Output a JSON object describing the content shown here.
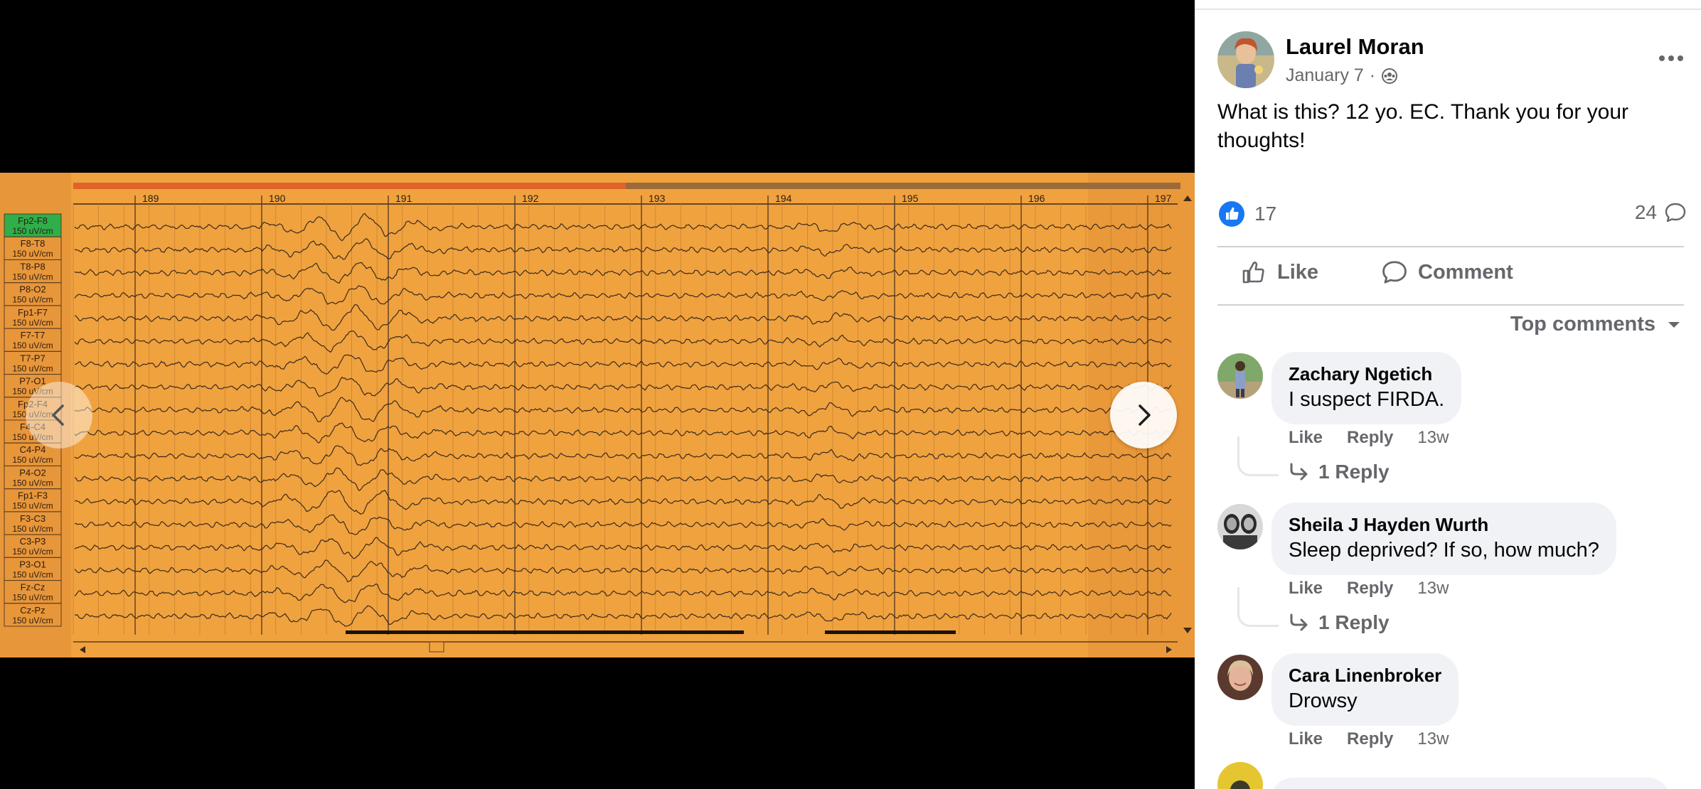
{
  "viewer": {
    "eeg": {
      "ruler": [
        "189",
        "190",
        "191",
        "192",
        "193",
        "194",
        "195",
        "196",
        "197"
      ],
      "channels": [
        {
          "label": "Fp2-F8",
          "scale": "150 uV/cm"
        },
        {
          "label": "F8-T8",
          "scale": "150 uV/cm"
        },
        {
          "label": "T8-P8",
          "scale": "150 uV/cm"
        },
        {
          "label": "P8-O2",
          "scale": "150 uV/cm"
        },
        {
          "label": "Fp1-F7",
          "scale": "150 uV/cm"
        },
        {
          "label": "F7-T7",
          "scale": "150 uV/cm"
        },
        {
          "label": "T7-P7",
          "scale": "150 uV/cm"
        },
        {
          "label": "P7-O1",
          "scale": "150 uV/cm"
        },
        {
          "label": "Fp2-F4",
          "scale": "150 uV/cm"
        },
        {
          "label": "F4-C4",
          "scale": "150 uV/cm"
        },
        {
          "label": "C4-P4",
          "scale": "150 uV/cm"
        },
        {
          "label": "P4-O2",
          "scale": "150 uV/cm"
        },
        {
          "label": "Fp1-F3",
          "scale": "150 uV/cm"
        },
        {
          "label": "F3-C3",
          "scale": "150 uV/cm"
        },
        {
          "label": "C3-P3",
          "scale": "150 uV/cm"
        },
        {
          "label": "P3-O1",
          "scale": "150 uV/cm"
        },
        {
          "label": "Fz-Cz",
          "scale": "150 uV/cm"
        },
        {
          "label": "Cz-Pz",
          "scale": "150 uV/cm"
        }
      ],
      "colors": {
        "background": "#f0a23f",
        "trace": "#3a2a1c",
        "gutter": "#e8963a",
        "selected_channel": "#2fae4a"
      }
    },
    "prev_icon": "chevron-left-icon",
    "next_icon": "chevron-right-icon"
  },
  "post": {
    "author": "Laurel Moran",
    "date": "January 7",
    "separator": "·",
    "audience_icon": "group-audience-icon",
    "text": "What is this? 12 yo. EC. Thank you for your thoughts!",
    "reaction_count": "17",
    "comment_count": "24",
    "actions": {
      "like": "Like",
      "comment": "Comment"
    },
    "sort_label": "Top comments",
    "colors": {
      "like_blue": "#1877f2",
      "secondary_text": "#65676b",
      "bubble": "#f0f2f5"
    }
  },
  "comments": [
    {
      "name": "Zachary Ngetich",
      "text": "I suspect FIRDA.",
      "like": "Like",
      "reply": "Reply",
      "time": "13w",
      "replies": "1 Reply"
    },
    {
      "name": "Sheila J Hayden Wurth",
      "text": "Sleep deprived? If so, how much?",
      "like": "Like",
      "reply": "Reply",
      "time": "13w",
      "replies": "1 Reply"
    },
    {
      "name": "Cara Linenbroker",
      "text": "Drowsy",
      "like": "Like",
      "reply": "Reply",
      "time": "13w"
    }
  ]
}
